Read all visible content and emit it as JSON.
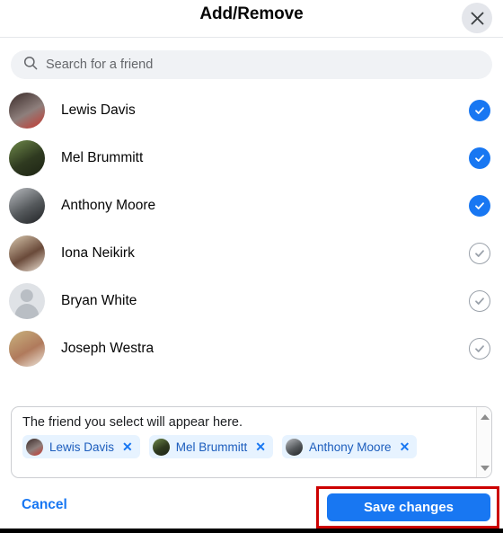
{
  "header": {
    "title": "Add/Remove",
    "close_icon": "close-icon",
    "close_label": "Close"
  },
  "search": {
    "icon": "search-icon",
    "placeholder": "Search for a friend",
    "value": ""
  },
  "friends": [
    {
      "name": "Lewis Davis",
      "selected": true,
      "avatar_type": "photo",
      "avatar_colors": [
        "#3a2a28",
        "#8e7f7c",
        "#c9372e"
      ]
    },
    {
      "name": "Mel Brummitt",
      "selected": true,
      "avatar_type": "photo",
      "avatar_colors": [
        "#6f8a4a",
        "#2f3a20",
        "#1d2414"
      ]
    },
    {
      "name": "Anthony Moore",
      "selected": true,
      "avatar_type": "photo",
      "avatar_colors": [
        "#b9bcc0",
        "#55595c",
        "#1f2124"
      ]
    },
    {
      "name": "Iona Neikirk",
      "selected": false,
      "avatar_type": "photo",
      "avatar_colors": [
        "#d9c8ae",
        "#6a4a3a",
        "#f0e4d6"
      ]
    },
    {
      "name": "Bryan White",
      "selected": false,
      "avatar_type": "placeholder",
      "avatar_colors": [
        "#dfe2e6",
        "#b9bec4",
        "#b9bec4"
      ]
    },
    {
      "name": "Joseph Westra",
      "selected": false,
      "avatar_type": "photo",
      "avatar_colors": [
        "#c9b37e",
        "#b07a5c",
        "#efe7dc"
      ]
    }
  ],
  "selection": {
    "hint": "The friend you select will appear here.",
    "chips": [
      {
        "name": "Lewis Davis",
        "remove_icon": "close-icon",
        "avatar_colors": [
          "#3a2a28",
          "#8e7f7c",
          "#c9372e"
        ]
      },
      {
        "name": "Mel Brummitt",
        "remove_icon": "close-icon",
        "avatar_colors": [
          "#6f8a4a",
          "#2f3a20",
          "#1d2414"
        ]
      },
      {
        "name": "Anthony Moore",
        "remove_icon": "close-icon",
        "avatar_colors": [
          "#b9bcc0",
          "#55595c",
          "#1f2124"
        ]
      }
    ],
    "scroll_up_icon": "chevron-up-icon",
    "scroll_down_icon": "chevron-down-icon"
  },
  "footer": {
    "cancel_label": "Cancel",
    "save_label": "Save changes"
  },
  "colors": {
    "accent": "#1877f2",
    "chip_background": "#e7f3ff",
    "chip_text": "#1c5dbd",
    "search_background": "#f0f2f5",
    "unchecked_outline": "#9aa1aa",
    "highlight": "#cc0000"
  },
  "selected_count": 3
}
